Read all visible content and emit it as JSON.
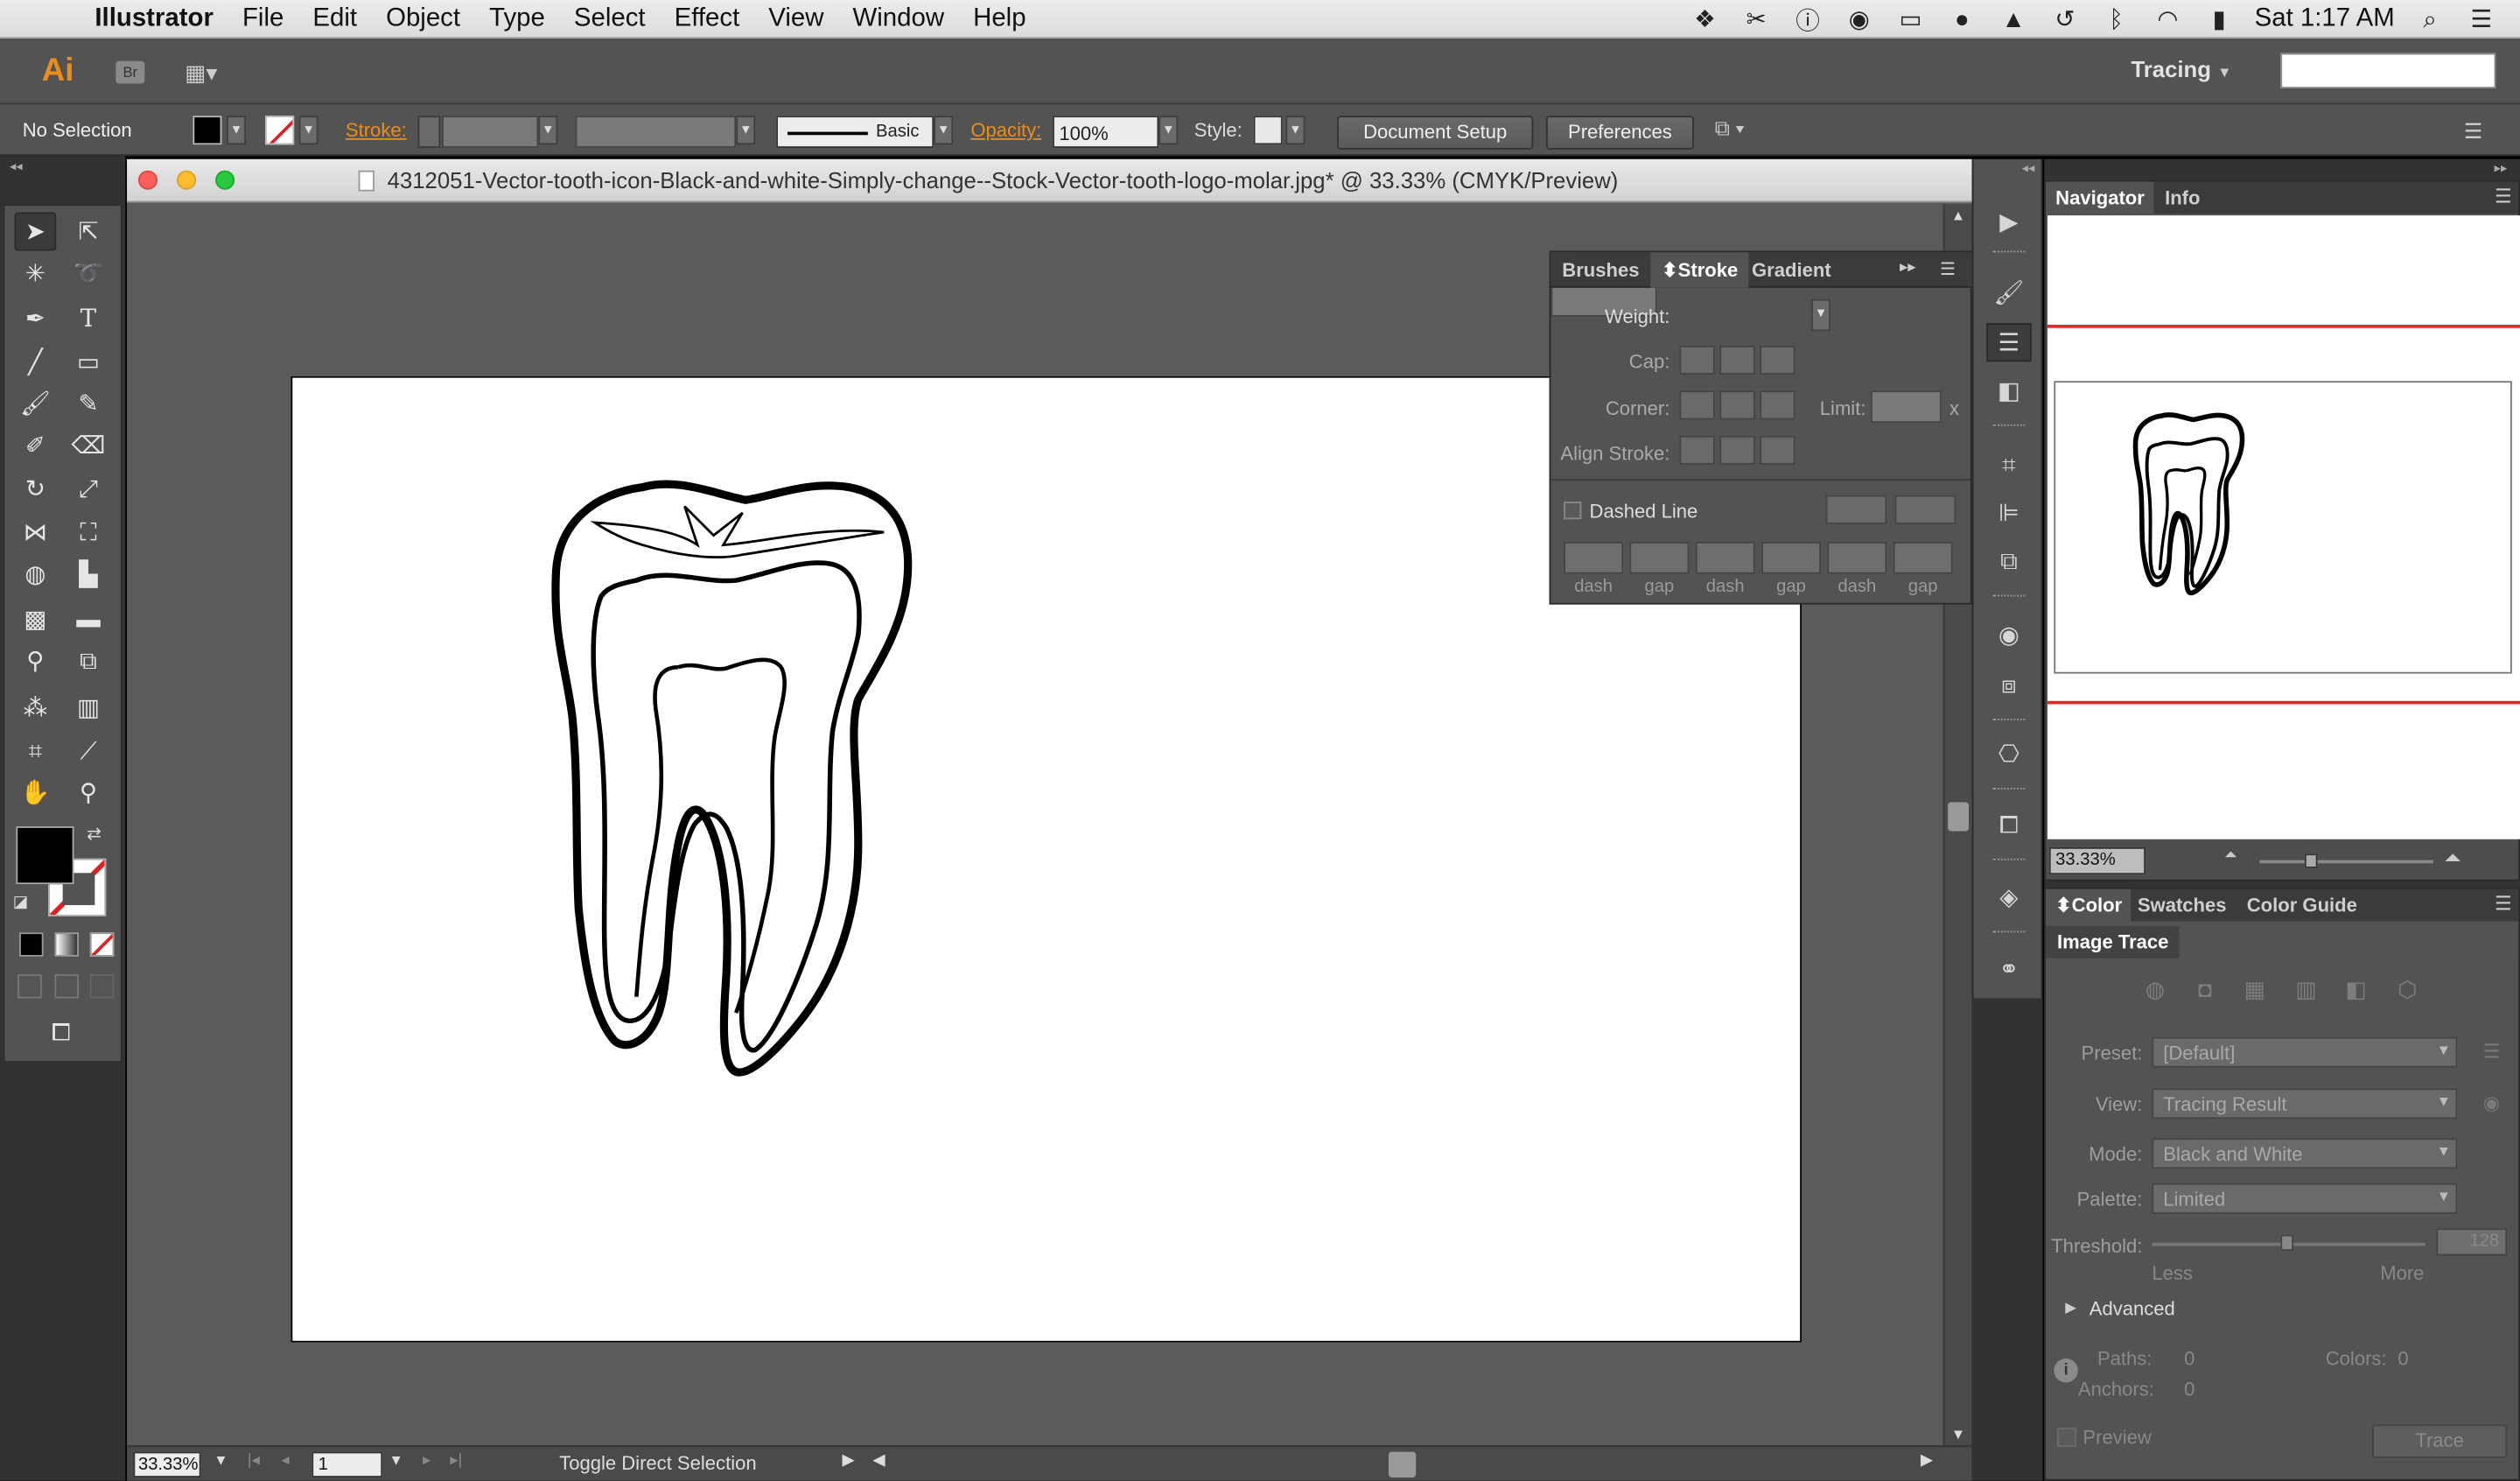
{
  "menubar": {
    "app": "Illustrator",
    "items": [
      "File",
      "Edit",
      "Object",
      "Type",
      "Select",
      "Effect",
      "View",
      "Window",
      "Help"
    ],
    "clock": "Sat 1:17 AM"
  },
  "appbar": {
    "logo": "Ai",
    "bridge": "Br",
    "workspace": "Tracing"
  },
  "control": {
    "selection": "No Selection",
    "stroke_label": "Stroke:",
    "brush_def": "Basic",
    "opacity_label": "Opacity:",
    "opacity_value": "100%",
    "style_label": "Style:",
    "document_setup": "Document Setup",
    "preferences": "Preferences"
  },
  "document": {
    "title": "4312051-Vector-tooth-icon-Black-and-white-Simply-change--Stock-Vector-tooth-logo-molar.jpg* @ 33.33% (CMYK/Preview)",
    "zoom": "33.33%",
    "page": "1",
    "status": "Toggle Direct Selection"
  },
  "stroke_panel": {
    "tabs": [
      "Brushes",
      "Stroke",
      "Gradient"
    ],
    "weight_label": "Weight:",
    "cap_label": "Cap:",
    "corner_label": "Corner:",
    "limit_label": "Limit:",
    "limit_unit": "x",
    "align_label": "Align Stroke:",
    "dashed_label": "Dashed Line",
    "dash_labels": [
      "dash",
      "gap",
      "dash",
      "gap",
      "dash",
      "gap"
    ]
  },
  "navigator": {
    "tabs": [
      "Navigator",
      "Info"
    ],
    "zoom": "33.33%"
  },
  "color_panel": {
    "tabs": [
      "Color",
      "Swatches",
      "Color Guide"
    ]
  },
  "image_trace": {
    "title": "Image Trace",
    "preset_label": "Preset:",
    "preset_value": "[Default]",
    "view_label": "View:",
    "view_value": "Tracing Result",
    "mode_label": "Mode:",
    "mode_value": "Black and White",
    "palette_label": "Palette:",
    "palette_value": "Limited",
    "threshold_label": "Threshold:",
    "threshold_value": "128",
    "less": "Less",
    "more": "More",
    "advanced": "Advanced",
    "paths_label": "Paths:",
    "paths_value": "0",
    "colors_label": "Colors:",
    "colors_value": "0",
    "anchors_label": "Anchors:",
    "anchors_value": "0",
    "preview_label": "Preview",
    "trace_button": "Trace"
  }
}
